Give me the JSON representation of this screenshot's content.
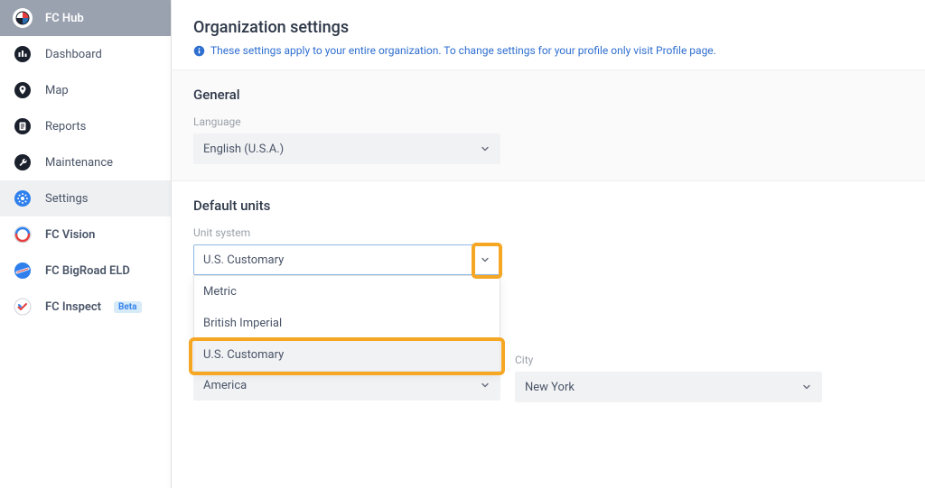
{
  "brand": {
    "name": "FC Hub"
  },
  "nav": {
    "dashboard": "Dashboard",
    "map": "Map",
    "reports": "Reports",
    "maintenance": "Maintenance",
    "settings": "Settings",
    "vision": "FC Vision",
    "bigroad": "FC BigRoad ELD",
    "inspect": "FC Inspect",
    "beta": "Beta"
  },
  "page": {
    "title": "Organization settings",
    "info": "These settings apply to your entire organization. To change settings for your profile only visit Profile page."
  },
  "general": {
    "heading": "General",
    "language_label": "Language",
    "language_value": "English (U.S.A.)"
  },
  "units": {
    "heading": "Default units",
    "system_label": "Unit system",
    "system_value": "U.S. Customary",
    "options": {
      "metric": "Metric",
      "british": "British Imperial",
      "us": "U.S. Customary"
    }
  },
  "tz": {
    "left_value": "America",
    "city_label": "City",
    "city_value": "New York"
  }
}
